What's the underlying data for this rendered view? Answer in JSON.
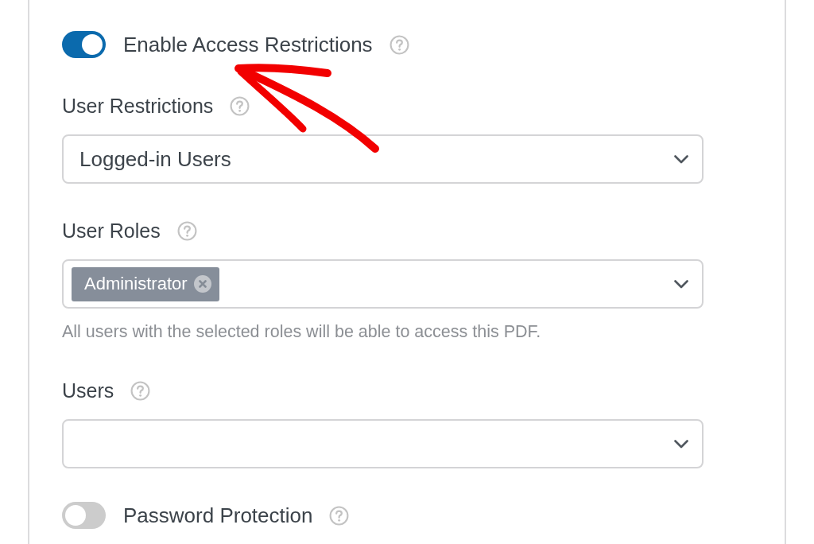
{
  "settings": [
    {
      "kind": "toggle",
      "label": "Enable Access Restrictions",
      "on": true
    },
    {
      "kind": "select",
      "label": "User Restrictions",
      "value": "Logged-in Users"
    },
    {
      "kind": "multiselect",
      "label": "User Roles",
      "tags": [
        "Administrator"
      ],
      "description": "All users with the selected roles will be able to access this PDF."
    },
    {
      "kind": "select",
      "label": "Users"
    },
    {
      "kind": "toggle",
      "label": "Password Protection",
      "on": false
    }
  ]
}
